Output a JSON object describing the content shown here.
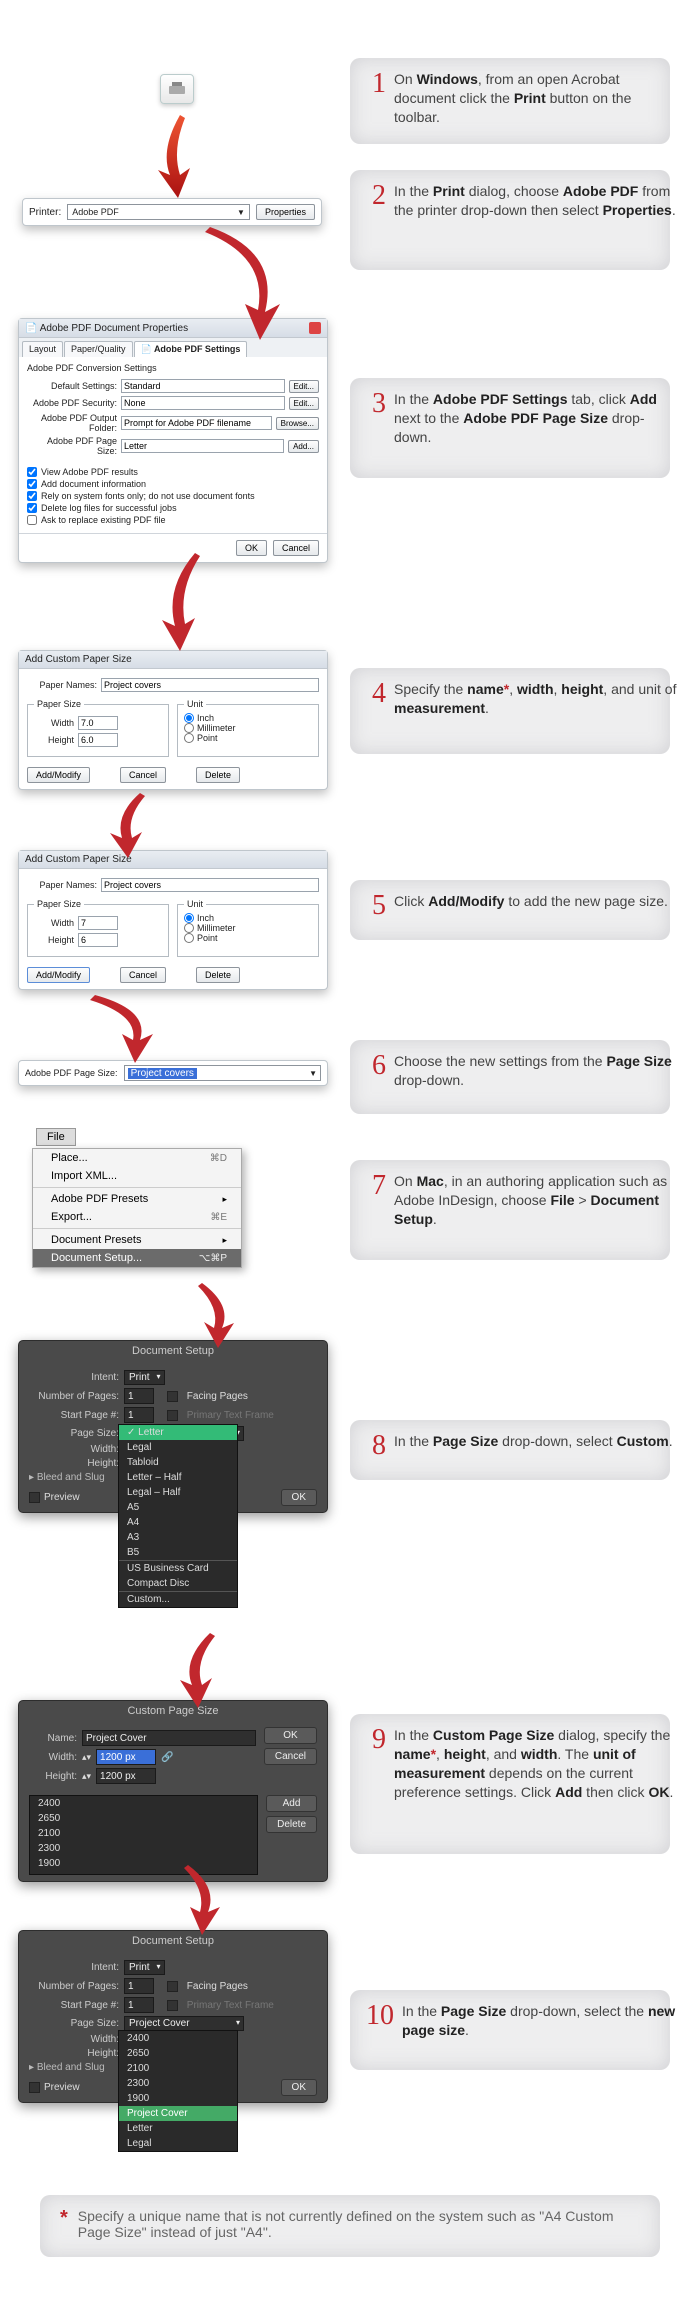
{
  "steps": [
    {
      "n": "1",
      "html": "On <b>Windows</b>, from an open Acrobat document click the <b>Print</b> button on the toolbar."
    },
    {
      "n": "2",
      "html": "In the <b>Print</b> dialog, choose <b>Adobe PDF</b> from the printer drop-down then select <b>Properties</b>."
    },
    {
      "n": "3",
      "html": "In the <b>Adobe PDF Settings</b> tab, click <b>Add</b> next to the <b>Adobe PDF Page Size</b> drop-down."
    },
    {
      "n": "4",
      "html": "Specify the <b>name</b><span class='ast'>*</span>, <b>width</b>, <b>height</b>, and unit of <b>measurement</b>."
    },
    {
      "n": "5",
      "html": "Click <b>Add/Modify</b> to add the new page size."
    },
    {
      "n": "6",
      "html": "Choose the new settings from the <b>Page Size</b> drop-down."
    },
    {
      "n": "7",
      "html": " On <b>Mac</b>, in an authoring application such as Adobe InDesign, choose <b>File</b> > <b>Document Setup</b>."
    },
    {
      "n": "8",
      "html": "In the <b>Page Size</b> drop-down, select <b>Custom</b>."
    },
    {
      "n": "9",
      "html": "In the <b>Custom Page Size</b> dialog, specify the <b>name</b><span class='ast'>*</span>, <b>height</b>, and <b>width</b>. The <b>unit of measurement</b> depends on the current preference settings. Click <b>Add</b> then click <b>OK</b>."
    },
    {
      "n": "10",
      "html": "In the <b>Page Size</b> drop-down, select the <b>new page size</b>."
    }
  ],
  "footnote": "Specify a unique name that is not currently defined on the system such as \"A4 Custom Page Size\" instead of just \"A4\".",
  "printBar": {
    "printerLabel": "Printer:",
    "printerValue": "Adobe PDF",
    "propertiesBtn": "Properties"
  },
  "propsDialog": {
    "title": "Adobe PDF Document Properties",
    "tabs": [
      "Layout",
      "Paper/Quality",
      "Adobe PDF Settings"
    ],
    "section": "Adobe PDF Conversion Settings",
    "fields": {
      "defaultSettings": {
        "label": "Default Settings:",
        "value": "Standard",
        "edit": "Edit..."
      },
      "security": {
        "label": "Adobe PDF Security:",
        "value": "None",
        "edit": "Edit..."
      },
      "outputFolder": {
        "label": "Adobe PDF Output Folder:",
        "value": "Prompt for Adobe PDF filename",
        "browse": "Browse..."
      },
      "pageSize": {
        "label": "Adobe PDF Page Size:",
        "value": "Letter",
        "add": "Add..."
      }
    },
    "checks": [
      "View Adobe PDF results",
      "Add document information",
      "Rely on system fonts only; do not use document fonts",
      "Delete log files for successful jobs",
      "Ask to replace existing PDF file"
    ],
    "ok": "OK",
    "cancel": "Cancel"
  },
  "addPaper1": {
    "title": "Add Custom Paper Size",
    "paperNames": "Paper Names:",
    "paperNamesVal": "Project covers",
    "paperSizeLegend": "Paper Size",
    "widthLbl": "Width",
    "widthVal": "7.0",
    "heightLbl": "Height",
    "heightVal": "6.0",
    "unitLegend": "Unit",
    "units": [
      "Inch",
      "Millimeter",
      "Point"
    ],
    "addModify": "Add/Modify",
    "cancel": "Cancel",
    "delete": "Delete"
  },
  "addPaper2": {
    "title": "Add Custom Paper Size",
    "paperNames": "Paper Names:",
    "paperNamesVal": "Project covers",
    "paperSizeLegend": "Paper Size",
    "widthLbl": "Width",
    "widthVal": "7",
    "heightLbl": "Height",
    "heightVal": "6",
    "unitLegend": "Unit",
    "units": [
      "Inch",
      "Millimeter",
      "Point"
    ],
    "addModify": "Add/Modify",
    "cancel": "Cancel",
    "delete": "Delete"
  },
  "pageSizeRow": {
    "label": "Adobe PDF Page Size:",
    "value": "Project covers"
  },
  "fileMenu": {
    "head": "File",
    "items": [
      {
        "label": "Place...",
        "sc": "⌘D"
      },
      {
        "label": "Import XML..."
      },
      {
        "sep": true
      },
      {
        "label": "Adobe PDF Presets",
        "sub": true
      },
      {
        "label": "Export...",
        "sc": "⌘E"
      },
      {
        "sep": true
      },
      {
        "label": "Document Presets",
        "sub": true
      },
      {
        "label": "Document Setup...",
        "sc": "⌥⌘P",
        "hi": true
      }
    ]
  },
  "docSetup1": {
    "title": "Document Setup",
    "intent": "Intent:",
    "intentVal": "Print",
    "numPages": "Number of Pages:",
    "numPagesVal": "1",
    "facing": "Facing Pages",
    "startPage": "Start Page #:",
    "startPageVal": "1",
    "ptf": "Primary Text Frame",
    "pageSize": "Page Size:",
    "pageSizeVal": "Letter",
    "width": "Width:",
    "height": "Height:",
    "bleed": "Bleed and Slug",
    "preview": "Preview",
    "ok": "OK",
    "dropItems": [
      "Letter",
      "Legal",
      "Tabloid",
      "Letter – Half",
      "Legal – Half",
      "A5",
      "A4",
      "A3",
      "B5",
      "",
      "US Business Card",
      "Compact Disc",
      "",
      "Custom..."
    ]
  },
  "customPage": {
    "title": "Custom Page Size",
    "name": "Name:",
    "nameVal": "Project Cover",
    "width": "Width:",
    "widthVal": "1200 px",
    "height": "Height:",
    "heightVal": "1200 px",
    "ok": "OK",
    "cancel": "Cancel",
    "add": "Add",
    "delete": "Delete",
    "list": [
      "2400",
      "2650",
      "2100",
      "2300",
      "1900"
    ]
  },
  "docSetup2": {
    "title": "Document Setup",
    "intent": "Intent:",
    "intentVal": "Print",
    "numPages": "Number of Pages:",
    "numPagesVal": "1",
    "facing": "Facing Pages",
    "startPage": "Start Page #:",
    "startPageVal": "1",
    "ptf": "Primary Text Frame",
    "pageSize": "Page Size:",
    "pageSizeVal": "Project Cover",
    "width": "Width:",
    "height": "Height:",
    "bleed": "Bleed and Slug",
    "preview": "Preview",
    "ok": "OK",
    "dropItems": [
      "2400",
      "2650",
      "2100",
      "2300",
      "1900",
      "Project Cover",
      "Letter",
      "Legal"
    ]
  }
}
